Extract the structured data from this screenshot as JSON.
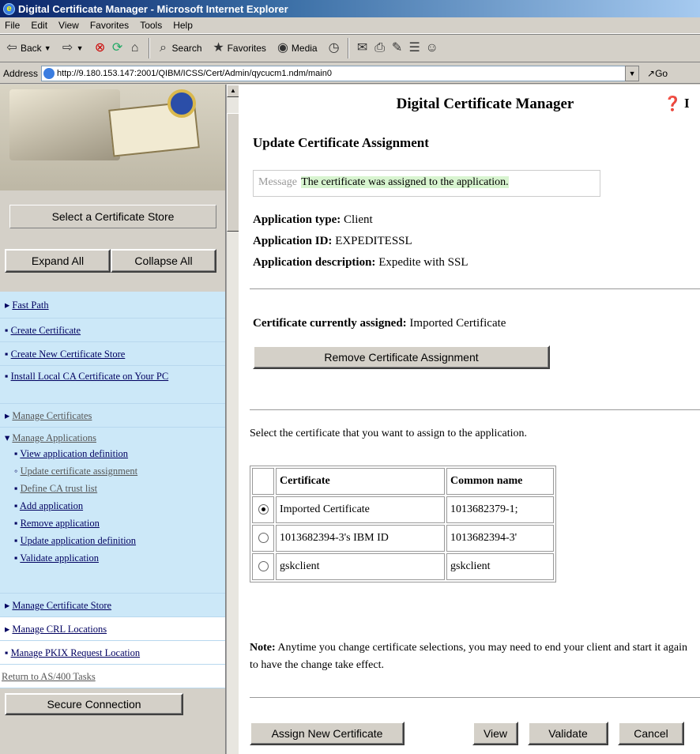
{
  "window": {
    "title": "Digital Certificate Manager - Microsoft Internet Explorer"
  },
  "menu": [
    "File",
    "Edit",
    "View",
    "Favorites",
    "Tools",
    "Help"
  ],
  "toolbar": {
    "back": "Back",
    "search": "Search",
    "favorites": "Favorites",
    "media": "Media"
  },
  "address": {
    "label": "Address",
    "url": "http://9.180.153.147:2001/QIBM/ICSS/Cert/Admin/qycucm1.ndm/main0",
    "go": "Go"
  },
  "left": {
    "select_store": "Select a Certificate Store",
    "expand_all": "Expand All",
    "collapse_all": "Collapse All",
    "nav": {
      "fast_path": "Fast Path",
      "create_certificate": "Create Certificate",
      "create_store": "Create New Certificate Store",
      "install_ca": "Install Local CA Certificate on Your PC",
      "manage_certificates": "Manage Certificates",
      "manage_applications": "Manage Applications",
      "view_app_def": "View application definition",
      "update_cert_assign": "Update certificate assignment",
      "define_ca_trust": "Define CA trust list",
      "add_app": "Add application",
      "remove_app": "Remove application",
      "update_app_def": "Update application definition",
      "validate_app": "Validate application",
      "manage_store": "Manage Certificate Store",
      "manage_crl": "Manage CRL Locations",
      "manage_pkix": "Manage PKIX Request Location",
      "return": "Return to AS/400 Tasks"
    },
    "secure_connection": "Secure Connection"
  },
  "main": {
    "header": "Digital Certificate Manager",
    "page_title": "Update Certificate Assignment",
    "message_label": "Message",
    "message_text": "The certificate was assigned to the application.",
    "app_type_label": "Application type:",
    "app_type_value": "Client",
    "app_id_label": "Application ID:",
    "app_id_value": "EXPEDITESSL",
    "app_desc_label": "Application description:",
    "app_desc_value": "Expedite with SSL",
    "assigned_label": "Certificate currently assigned:",
    "assigned_value": "Imported Certificate",
    "remove_button": "Remove Certificate Assignment",
    "select_text": "Select the certificate that you want to assign to the application.",
    "table": {
      "headers": [
        "Certificate",
        "Common name"
      ],
      "rows": [
        {
          "certificate": "Imported Certificate",
          "common_name": "1013682379-1;"
        },
        {
          "certificate": "1013682394-3's IBM ID",
          "common_name": "1013682394-3'"
        },
        {
          "certificate": "gskclient",
          "common_name": "gskclient"
        }
      ]
    },
    "note_label": "Note:",
    "note_text": "Anytime you change certificate selections, you may need to end your client and start it again to have the change take effect.",
    "buttons": {
      "assign": "Assign New Certificate",
      "view": "View",
      "validate": "Validate",
      "cancel": "Cancel"
    }
  }
}
